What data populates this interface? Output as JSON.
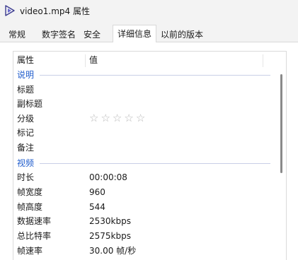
{
  "window": {
    "title": "video1.mp4 属性",
    "icon": "video-file-icon"
  },
  "tabs": [
    {
      "label": "常规"
    },
    {
      "label": "数字签名"
    },
    {
      "label": "安全"
    },
    {
      "label": "详细信息",
      "active": true
    },
    {
      "label": "以前的版本"
    }
  ],
  "table": {
    "columns": [
      "属性",
      "值"
    ],
    "groups": [
      {
        "label": "说明",
        "rows": [
          {
            "name": "标题",
            "value": ""
          },
          {
            "name": "副标题",
            "value": ""
          },
          {
            "name": "分级",
            "value": "",
            "rating": 0,
            "rating_max": 5
          },
          {
            "name": "标记",
            "value": ""
          },
          {
            "name": "备注",
            "value": ""
          }
        ]
      },
      {
        "label": "视频",
        "rows": [
          {
            "name": "时长",
            "value": "00:00:08"
          },
          {
            "name": "帧宽度",
            "value": "960"
          },
          {
            "name": "帧高度",
            "value": "544"
          },
          {
            "name": "数据速率",
            "value": "2530kbps"
          },
          {
            "name": "总比特率",
            "value": "2575kbps"
          },
          {
            "name": "帧速率",
            "value": "30.00 帧/秒"
          }
        ]
      }
    ]
  },
  "colors": {
    "group_heading": "#1f5ccc",
    "star_empty": "#b8b8b8"
  }
}
